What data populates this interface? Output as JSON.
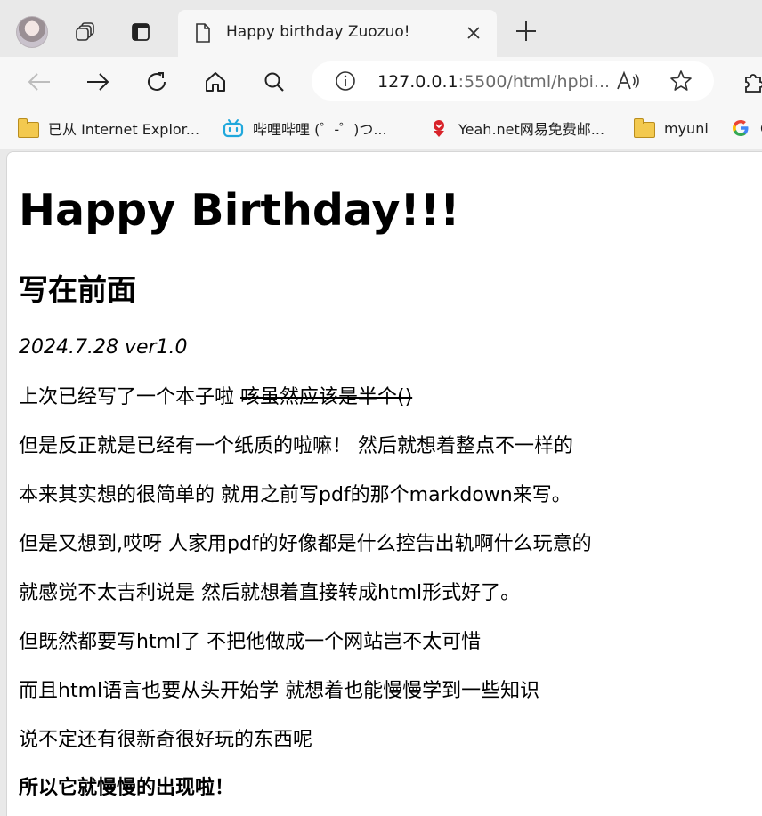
{
  "tabbar": {
    "active_tab": {
      "title": "Happy birthday Zuozuo!"
    }
  },
  "address_bar": {
    "url_host": "127.0.0.1",
    "url_rest": ":5500/html/hpbi..."
  },
  "bookmarks": [
    {
      "label": "已从 Internet Explor...",
      "icon": "folder-icon"
    },
    {
      "label": "哔哩哔哩 (゜-゜)つ...",
      "icon": "bilibili-icon"
    },
    {
      "label": "Yeah.net网易免费邮...",
      "icon": "yeah-net-icon"
    },
    {
      "label": "myuni",
      "icon": "folder-icon"
    },
    {
      "label": "G",
      "icon": "google-icon"
    }
  ],
  "page": {
    "h1": "Happy Birthday!!!",
    "h2": "写在前面",
    "version": "2024.7.28 ver1.0",
    "p1_normal": "上次已经写了一个本子啦 ",
    "p1_strike": "咳虽然应该是半个()",
    "p2": "但是反正就是已经有一个纸质的啦嘛！ 然后就想着整点不一样的",
    "p3": "本来其实想的很简单的 就用之前写pdf的那个markdown来写。",
    "p4": "但是又想到,哎呀 人家用pdf的好像都是什么控告出轨啊什么玩意的",
    "p5": "就感觉不太吉利说是 然后就想着直接转成html形式好了。",
    "p6": "但既然都要写html了 不把他做成一个网站岂不太可惜",
    "p7": "而且html语言也要从头开始学 就想着也能慢慢学到一些知识",
    "p8": "说不定还有很新奇很好玩的东西呢",
    "p9": "所以它就慢慢的出现啦！"
  }
}
